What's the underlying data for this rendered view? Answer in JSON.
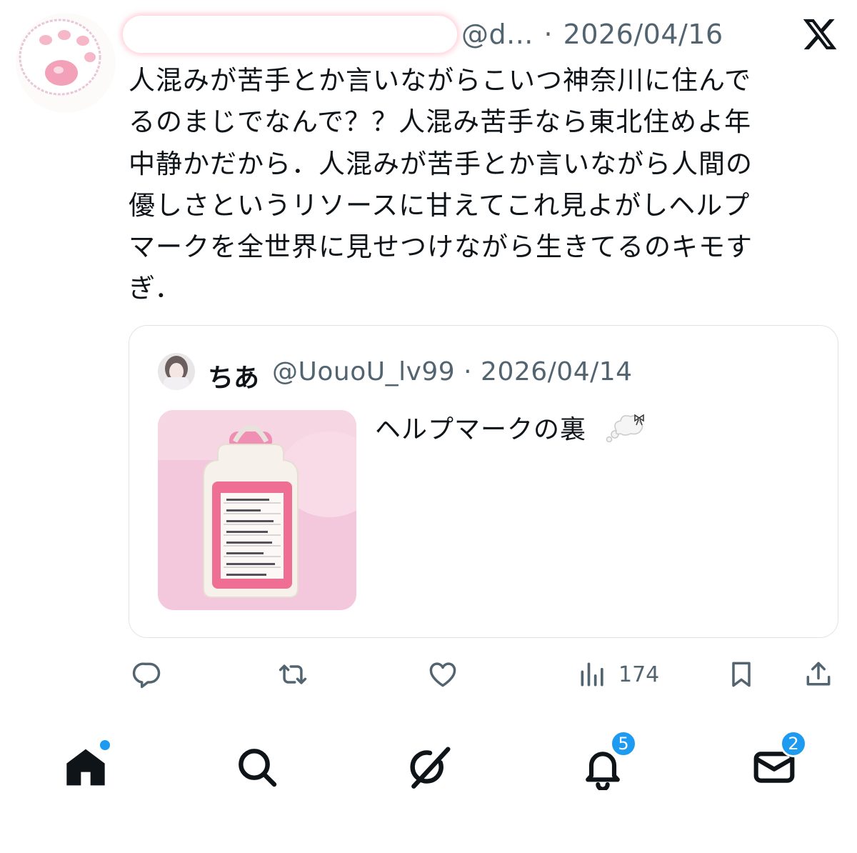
{
  "tweet": {
    "handle": "@d...",
    "separator": "·",
    "date": "2026/04/16",
    "text": "人混みが苦手とか言いながらこいつ神奈川に住んで\nるのまじでなんで？？人混み苦手なら東北住めよ年\n中静かだから．人混みが苦手とか言いながら人間の\n優しさというリソースに甘えてこれ見よがしヘルプ\nマークを全世界に見せつけながら生きてるのキモす\nぎ．"
  },
  "quote": {
    "name": "ちあ",
    "handle": "@UouoU_lv99",
    "separator": "·",
    "date": "2026/04/14",
    "text": "ヘルプマークの裏"
  },
  "actions": {
    "views": "174"
  },
  "tabbar": {
    "notifications_badge": "5",
    "messages_badge": "2"
  },
  "icons": {
    "logo": "x-logo-icon",
    "reply": "reply-icon",
    "repost": "repost-icon",
    "like": "like-icon",
    "views": "views-icon",
    "bookmark": "bookmark-icon",
    "share": "share-icon",
    "home": "home-icon",
    "search": "search-icon",
    "grok": "grok-icon",
    "notifications": "bell-icon",
    "messages": "envelope-icon"
  },
  "colors": {
    "text": "#0f1419",
    "secondary": "#536471",
    "accent": "#1d9bf0",
    "border": "#dfe3e7"
  }
}
